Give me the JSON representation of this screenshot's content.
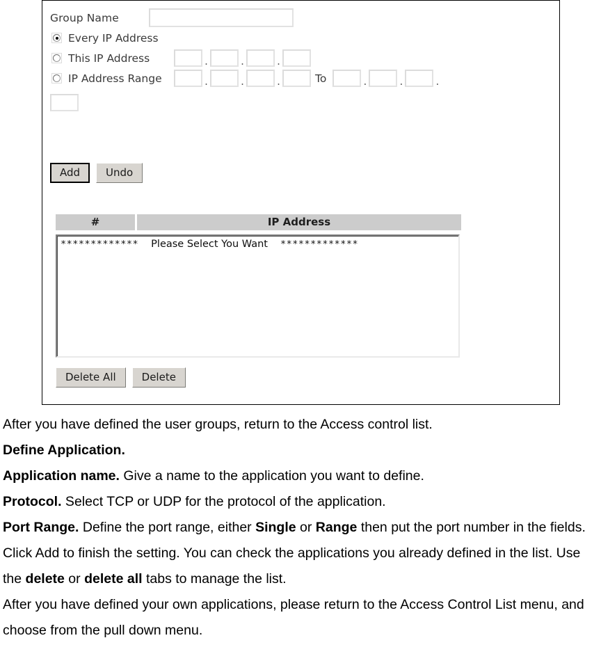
{
  "screenshot_panel": {
    "group_name": {
      "label": "Group Name",
      "value": "",
      "placeholder": ""
    },
    "radio_options": [
      {
        "label": "Every IP Address",
        "selected": true
      },
      {
        "label": "This IP Address",
        "selected": false
      },
      {
        "label": "IP Address Range",
        "selected": false
      }
    ],
    "this_ip_octets": [
      "",
      "",
      "",
      ""
    ],
    "range_from_octets": [
      "",
      "",
      "",
      ""
    ],
    "range_to_octets": [
      "",
      "",
      "",
      ""
    ],
    "separator_dot": ".",
    "to_label": "To",
    "buttons": {
      "add": "Add",
      "undo": "Undo",
      "delete_all": "Delete All",
      "delete": "Delete"
    },
    "table": {
      "headers": [
        "#",
        "IP Address"
      ],
      "rows": [
        {
          "left_stars": "*************",
          "text": "Please Select You Want",
          "right_stars": "*************"
        }
      ]
    }
  },
  "prose": {
    "line1": "After you have defined the user groups, return to the Access control list.",
    "heading": "Define Application.",
    "app_name_term": "Application name.",
    "app_name_text": " Give a name to the application you want to define.",
    "protocol_term": "Protocol.",
    "protocol_text": " Select TCP or UDP for the protocol of the application.",
    "port_range_term": "Port Range.",
    "port_range_text_a": " Define the port range, either ",
    "port_range_bold_single": "Single",
    "port_range_text_b": " or ",
    "port_range_bold_range": "Range",
    "port_range_text_c": " then put the port number in the fields. Click Add to finish the setting. You can check the applications you already defined in the list. Use the ",
    "port_range_bold_delete": "delete",
    "port_range_text_d": " or ",
    "port_range_bold_delete_all": "delete all",
    "port_range_text_e": " tabs to manage the list.",
    "closing": "After you have defined your own applications, please return to the Access Control List menu, and choose from the pull down menu."
  }
}
